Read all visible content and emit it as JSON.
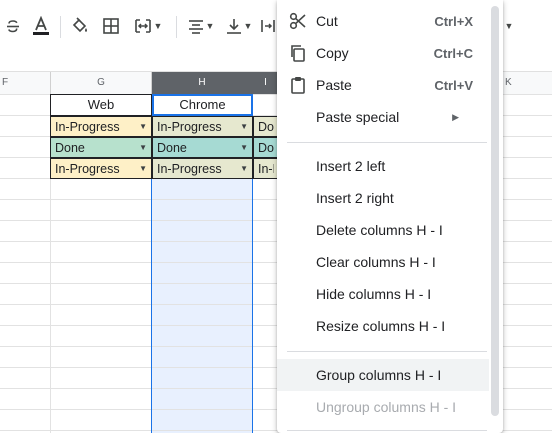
{
  "toolbar": {
    "icons": [
      "strikethrough-icon",
      "text-color-icon",
      "fill-color-icon",
      "borders-icon",
      "merge-cells-icon",
      "align-horizontal-icon",
      "align-vertical-icon",
      "text-wrap-icon"
    ]
  },
  "colors": {
    "selected_header": "#5f6368",
    "selection_fill": "#e8f0fe",
    "selection_border": "#1a73e8",
    "in_progress_chip": "#fef0c7",
    "done_chip": "#b7e1cd",
    "in_progress_chip_selected": "#e6e8cf",
    "done_chip_selected": "#a6dad3"
  },
  "sheet": {
    "column_headers": {
      "f": "F",
      "g": "G",
      "h": "H",
      "i": "I",
      "k": "K"
    },
    "header_row": {
      "g": "Web",
      "h": "Chrome"
    },
    "rows": [
      {
        "g": "In-Progress",
        "h": "In-Progress",
        "i": "Don"
      },
      {
        "g": "Done",
        "h": "Done",
        "i": "Don"
      },
      {
        "g": "In-Progress",
        "h": "In-Progress",
        "i": "In-P"
      }
    ]
  },
  "menu": {
    "cut": {
      "label": "Cut",
      "shortcut": "Ctrl+X"
    },
    "copy": {
      "label": "Copy",
      "shortcut": "Ctrl+C"
    },
    "paste": {
      "label": "Paste",
      "shortcut": "Ctrl+V"
    },
    "paste_special": {
      "label": "Paste special"
    },
    "insert_left": {
      "label": "Insert 2 left"
    },
    "insert_right": {
      "label": "Insert 2 right"
    },
    "delete_columns": {
      "label": "Delete columns H - I"
    },
    "clear_columns": {
      "label": "Clear columns H - I"
    },
    "hide_columns": {
      "label": "Hide columns H - I"
    },
    "resize_columns": {
      "label": "Resize columns H - I"
    },
    "group_columns": {
      "label": "Group columns H - I"
    },
    "ungroup_columns": {
      "label": "Ungroup columns H - I"
    }
  }
}
